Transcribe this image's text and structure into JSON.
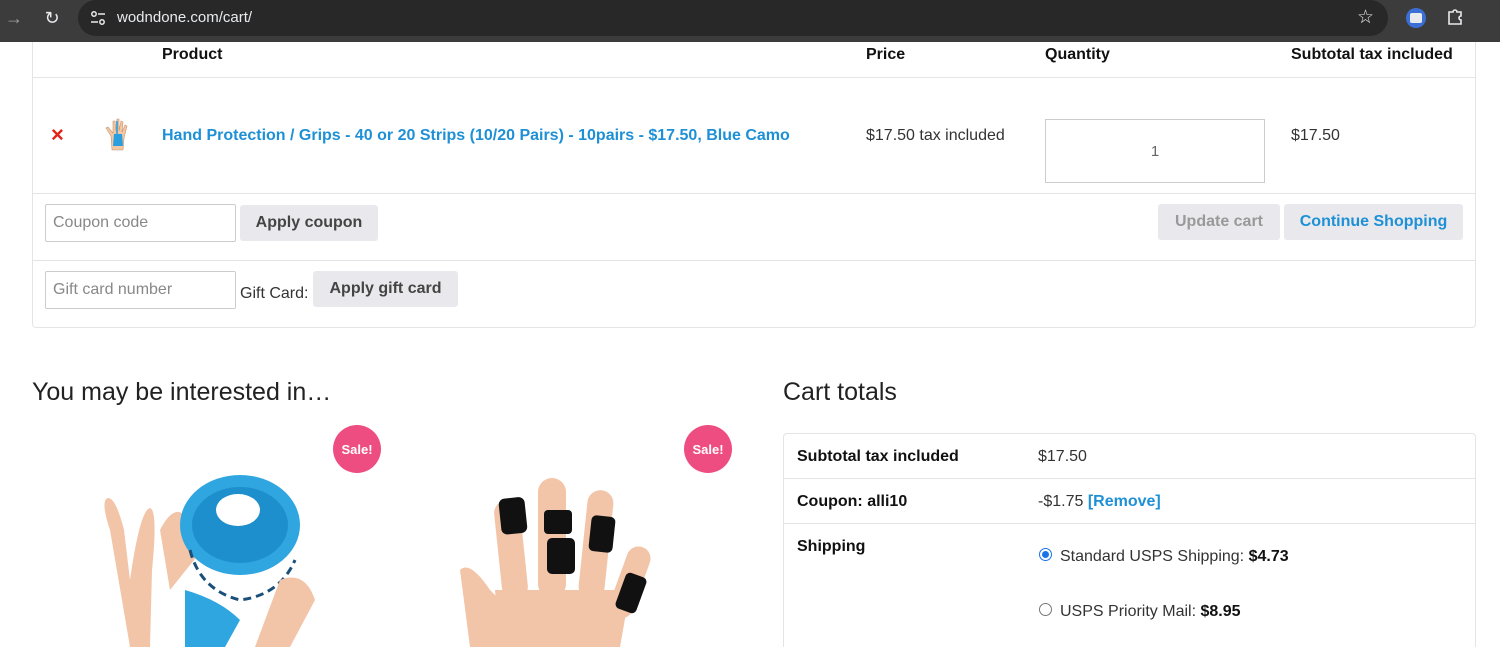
{
  "browser": {
    "url": "wodndone.com/cart/"
  },
  "cart": {
    "headers": {
      "product": "Product",
      "price": "Price",
      "quantity": "Quantity",
      "subtotal": "Subtotal tax included"
    },
    "item": {
      "remove_symbol": "×",
      "name": "Hand Protection / Grips - 40 or 20 Strips (10/20 Pairs) - 10pairs - $17.50, Blue Camo",
      "price": "$17.50 tax included",
      "quantity": "1",
      "subtotal": "$17.50"
    },
    "coupon": {
      "placeholder": "Coupon code",
      "apply_label": "Apply coupon",
      "update_label": "Update cart",
      "continue_label": "Continue Shopping"
    },
    "gift_card": {
      "placeholder": "Gift card number",
      "label": "Gift Card:",
      "apply_label": "Apply gift card"
    }
  },
  "interested": {
    "title": "You may be interested in…",
    "products": [
      {
        "badge": "Sale!"
      },
      {
        "badge": "Sale!"
      }
    ]
  },
  "totals": {
    "title": "Cart totals",
    "subtotal_label": "Subtotal tax included",
    "subtotal_value": "$17.50",
    "coupon_label": "Coupon: alli10",
    "coupon_value": "-$1.75",
    "coupon_remove": "[Remove]",
    "shipping_label": "Shipping",
    "shipping_options": [
      {
        "name": "Standard USPS Shipping:",
        "price": "$4.73",
        "selected": true
      },
      {
        "name": "USPS Priority Mail:",
        "price": "$8.95",
        "selected": false
      }
    ]
  },
  "colors": {
    "accent": "#1e90d6",
    "sale_badge": "#ee4d82",
    "remove": "#e2231a"
  }
}
